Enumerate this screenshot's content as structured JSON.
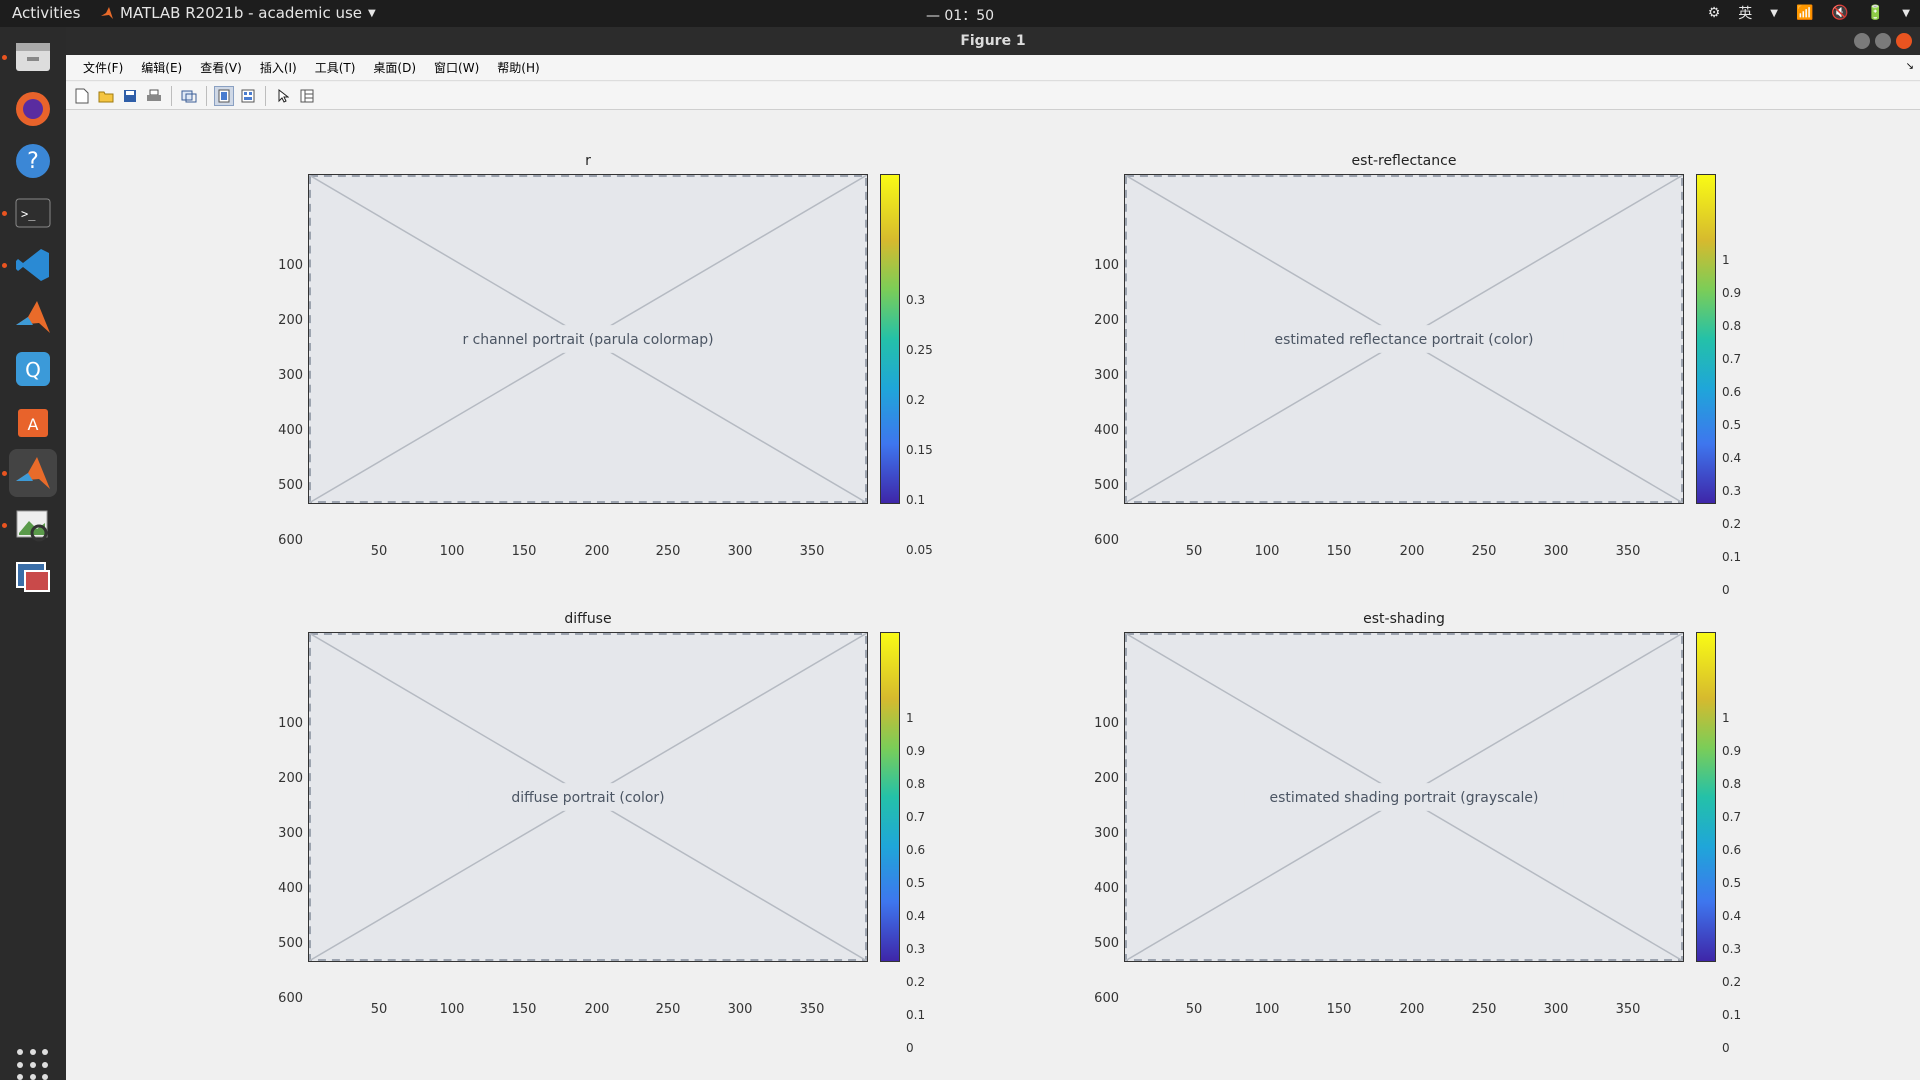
{
  "topbar": {
    "activities": "Activities",
    "app_name": "MATLAB R2021b - academic use",
    "clock": "— 01：50",
    "input_method": "英"
  },
  "dock": {
    "apps": [
      "files-app",
      "firefox-app",
      "help-app",
      "terminal-app",
      "vscode-app",
      "matlab-app",
      "zotero-app",
      "software-center-app",
      "matlab-active-app",
      "image-viewer-app",
      "photo-app"
    ]
  },
  "window": {
    "title": "Figure 1"
  },
  "menu": {
    "items": [
      "文件(F)",
      "编辑(E)",
      "查看(V)",
      "插入(I)",
      "工具(T)",
      "桌面(D)",
      "窗口(W)",
      "帮助(H)"
    ]
  },
  "plots": [
    {
      "title": "r",
      "image_label": "r channel portrait (parula colormap)",
      "yticks": [
        "100",
        "200",
        "300",
        "400",
        "500",
        "600"
      ],
      "xticks": [
        "50",
        "100",
        "150",
        "200",
        "250",
        "300",
        "350"
      ],
      "cticks": [
        "0.3",
        "0.25",
        "0.2",
        "0.15",
        "0.1",
        "0.05"
      ]
    },
    {
      "title": "est-reflectance",
      "image_label": "estimated reflectance portrait (color)",
      "yticks": [
        "100",
        "200",
        "300",
        "400",
        "500",
        "600"
      ],
      "xticks": [
        "50",
        "100",
        "150",
        "200",
        "250",
        "300",
        "350"
      ],
      "cticks": [
        "1",
        "0.9",
        "0.8",
        "0.7",
        "0.6",
        "0.5",
        "0.4",
        "0.3",
        "0.2",
        "0.1",
        "0"
      ]
    },
    {
      "title": "diffuse",
      "image_label": "diffuse portrait (color)",
      "yticks": [
        "100",
        "200",
        "300",
        "400",
        "500",
        "600"
      ],
      "xticks": [
        "50",
        "100",
        "150",
        "200",
        "250",
        "300",
        "350"
      ],
      "cticks": [
        "1",
        "0.9",
        "0.8",
        "0.7",
        "0.6",
        "0.5",
        "0.4",
        "0.3",
        "0.2",
        "0.1",
        "0"
      ]
    },
    {
      "title": "est-shading",
      "image_label": "estimated shading portrait (grayscale)",
      "yticks": [
        "100",
        "200",
        "300",
        "400",
        "500",
        "600"
      ],
      "xticks": [
        "50",
        "100",
        "150",
        "200",
        "250",
        "300",
        "350"
      ],
      "cticks": [
        "1",
        "0.9",
        "0.8",
        "0.7",
        "0.6",
        "0.5",
        "0.4",
        "0.3",
        "0.2",
        "0.1",
        "0"
      ]
    }
  ]
}
